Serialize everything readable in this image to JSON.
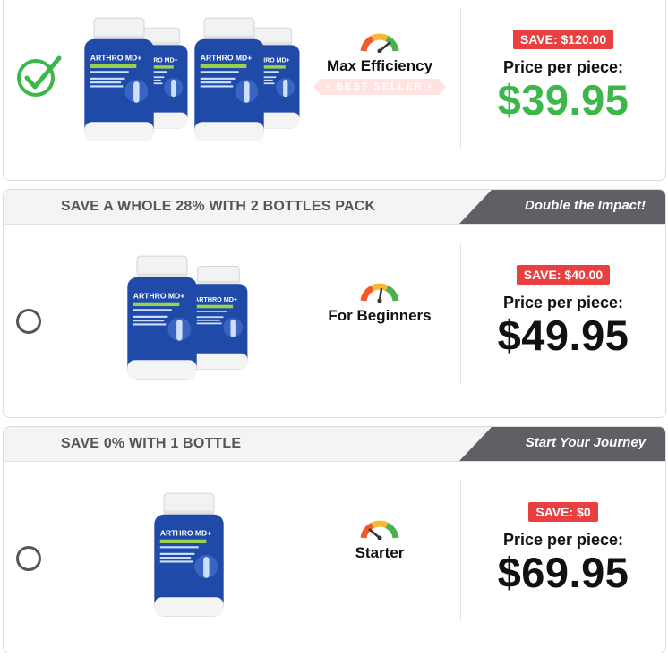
{
  "packages": [
    {
      "header": "",
      "ribbon": "",
      "selected": true,
      "tier": "Max Efficiency",
      "best_seller": "• BEST SELLER •",
      "save": "SAVE: $120.00",
      "price_label": "Price per piece:",
      "price": "$39.95",
      "price_color": "#3cb74a",
      "bottle_count": 4
    },
    {
      "header": "SAVE A WHOLE 28% WITH 2 BOTTLES PACK",
      "ribbon": "Double the Impact!",
      "selected": false,
      "tier": "For Beginners",
      "save": "SAVE: $40.00",
      "price_label": "Price per piece:",
      "price": "$49.95",
      "bottle_count": 2
    },
    {
      "header": "SAVE 0% WITH 1 BOTTLE",
      "ribbon": "Start Your Journey",
      "selected": false,
      "tier": "Starter",
      "save": "SAVE: $0",
      "price_label": "Price per piece:",
      "price": "$69.95",
      "bottle_count": 1
    }
  ],
  "bottle_label": {
    "brand": "ARTHRO",
    "brand_suffix": "MD+",
    "line": "Joint Support Complex"
  },
  "colors": {
    "bottle_blue": "#1f4aa8",
    "accent_green": "#3cb74a",
    "badge_red": "#e84040",
    "ribbon_grey": "#5f5f66"
  },
  "icons": {
    "selected": "checkmark-icon",
    "unselected": "radio-empty-icon",
    "tier": "gauge-icon"
  }
}
